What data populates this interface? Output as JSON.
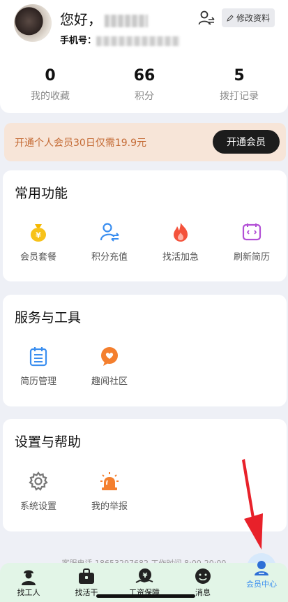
{
  "profile": {
    "greeting": "您好，",
    "phone_label": "手机号：",
    "edit_label": "修改资料",
    "stats": [
      {
        "value": "0",
        "label": "我的收藏"
      },
      {
        "value": "66",
        "label": "积分"
      },
      {
        "value": "5",
        "label": "拨打记录"
      }
    ]
  },
  "promo": {
    "text": "开通个人会员30日仅需19.9元",
    "button": "开通会员"
  },
  "sections": [
    {
      "title": "常用功能",
      "items": [
        {
          "label": "会员套餐",
          "icon": "money-bag-icon"
        },
        {
          "label": "积分充值",
          "icon": "user-exchange-icon"
        },
        {
          "label": "找活加急",
          "icon": "fire-icon"
        },
        {
          "label": "刷新简历",
          "icon": "refresh-icon"
        }
      ]
    },
    {
      "title": "服务与工具",
      "items": [
        {
          "label": "简历管理",
          "icon": "clipboard-icon"
        },
        {
          "label": "趣闻社区",
          "icon": "chat-heart-icon"
        }
      ]
    },
    {
      "title": "设置与帮助",
      "items": [
        {
          "label": "系统设置",
          "icon": "gear-icon"
        },
        {
          "label": "我的举报",
          "icon": "alarm-icon"
        }
      ]
    }
  ],
  "hotline": "客服电话 18653297682  工作时间 8:00-20:00",
  "tabbar": {
    "tabs": [
      {
        "label": "找工人",
        "icon": "worker-icon"
      },
      {
        "label": "找活干",
        "icon": "briefcase-icon"
      },
      {
        "label": "工资保障",
        "icon": "salary-icon"
      },
      {
        "label": "消息",
        "icon": "message-icon"
      },
      {
        "label": "会员中心",
        "icon": "member-icon"
      }
    ],
    "active": "会员中心"
  },
  "colors": {
    "accent": "#3a8ef0",
    "promo_bg": "#f7e5d8",
    "promo_text": "#c46a34",
    "tabbar_bg": "#e2f5e7",
    "annotation_arrow": "#e8212a"
  }
}
